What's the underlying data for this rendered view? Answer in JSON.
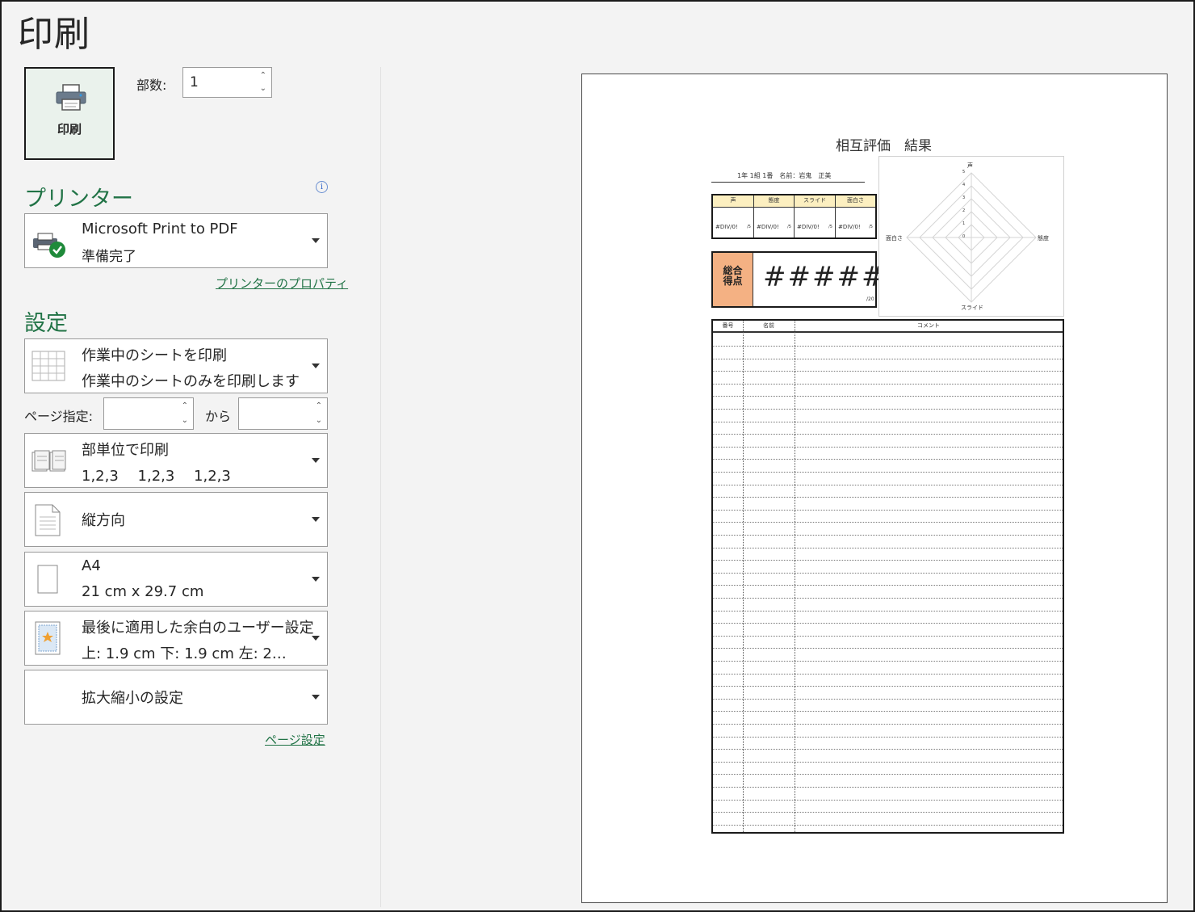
{
  "title": "印刷",
  "print_button": {
    "label": "印刷"
  },
  "copies": {
    "label": "部数:",
    "value": "1"
  },
  "printer": {
    "section": "プリンター",
    "name": "Microsoft Print to PDF",
    "status": "準備完了",
    "properties_link": "プリンターのプロパティ"
  },
  "settings": {
    "section": "設定",
    "scope": {
      "title": "作業中のシートを印刷",
      "desc": "作業中のシートのみを印刷します"
    },
    "pages": {
      "label": "ページ指定:",
      "from_label": "から"
    },
    "collate": {
      "title": "部単位で印刷",
      "desc": "1,2,3　 1,2,3　 1,2,3"
    },
    "orientation": {
      "title": "縦方向"
    },
    "paper": {
      "title": "A4",
      "desc": "21 cm x 29.7 cm"
    },
    "margins": {
      "title": "最後に適用した余白のユーザー設定",
      "desc": "上: 1.9 cm 下: 1.9 cm 左: 2…"
    },
    "scaling": {
      "title": "拡大縮小の設定"
    },
    "page_setup_link": "ページ設定"
  },
  "preview": {
    "sheet_title": "相互評価　結果",
    "student": "1年 1組 1番　名前：岩鬼　正美",
    "score_headers": [
      "声",
      "態度",
      "スライド",
      "面白さ"
    ],
    "score_values": [
      "#DIV/0!",
      "#DIV/0!",
      "#DIV/0!",
      "#DIV/0!"
    ],
    "score_unit": "/5",
    "total_label": "総合\n得点",
    "total_value": "#####",
    "total_unit": "/20",
    "radar": {
      "axes": [
        "声",
        "態度",
        "スライド",
        "面白さ"
      ],
      "ticks": [
        "0",
        "1",
        "2",
        "3",
        "4",
        "5"
      ]
    },
    "comment_headers": [
      "番号",
      "名前",
      "コメント"
    ]
  }
}
